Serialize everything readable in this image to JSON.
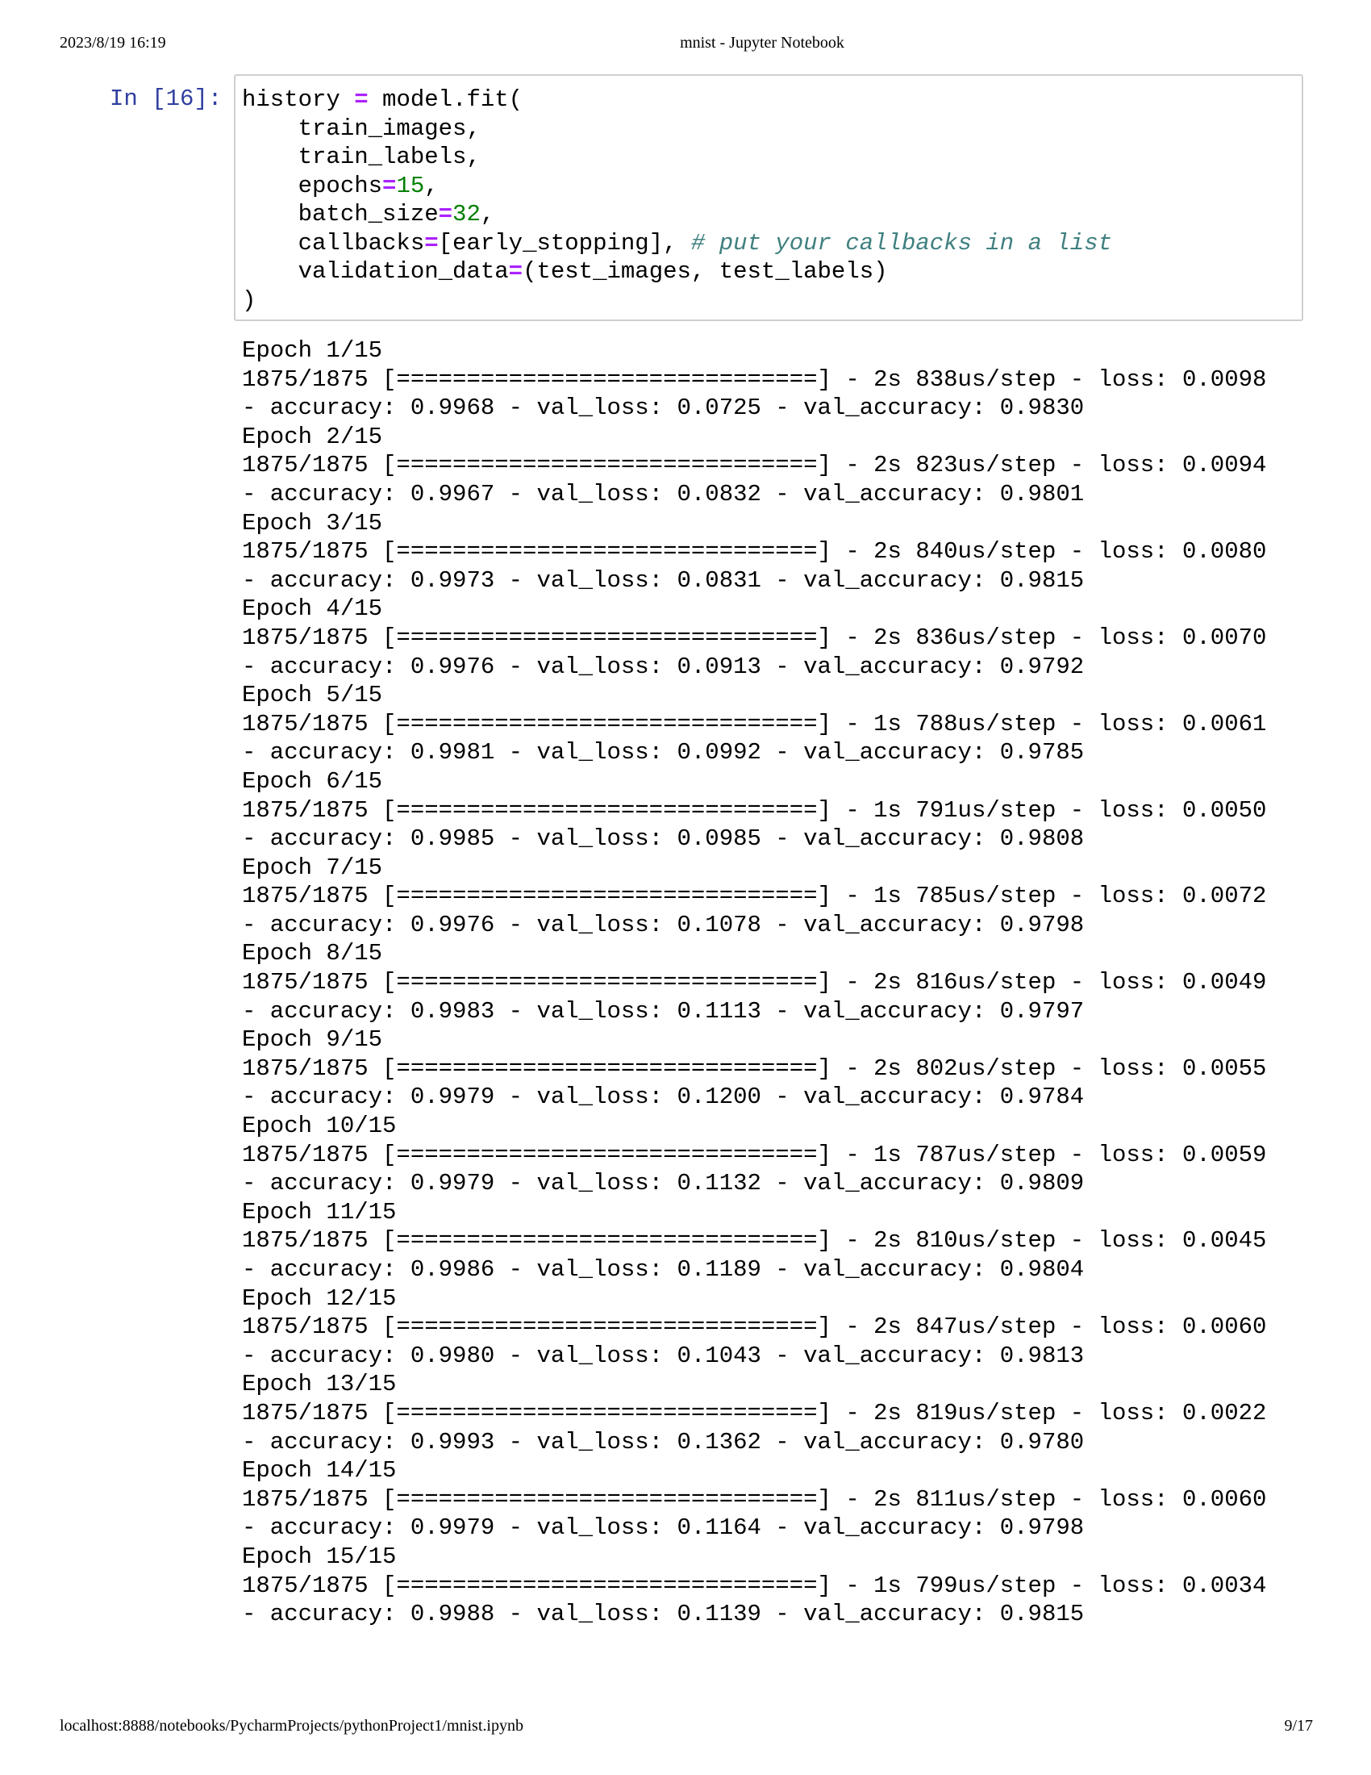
{
  "header": {
    "datetime": "2023/8/19 16:19",
    "title": "mnist - Jupyter Notebook"
  },
  "footer": {
    "url": "localhost:8888/notebooks/PycharmProjects/pythonProject1/mnist.ipynb",
    "page": "9/17"
  },
  "cell": {
    "prompt": "In [16]:",
    "code": {
      "l1_var": "history",
      "l1_op": " = ",
      "l1_call": "model.fit(",
      "l2": "    train_images,",
      "l3": "    train_labels,",
      "l4_name": "    epochs",
      "l4_op": "=",
      "l4_val": "15",
      "l4_end": ",",
      "l5_name": "    batch_size",
      "l5_op": "=",
      "l5_val": "32",
      "l5_end": ",",
      "l6_name": "    callbacks",
      "l6_op": "=",
      "l6_val": "[early_stopping], ",
      "l6_comment": "# put your callbacks in a list",
      "l7_name": "    validation_data",
      "l7_op": "=",
      "l7_val": "(test_images, test_labels)",
      "l8": ")"
    },
    "output": [
      "Epoch 1/15",
      "1875/1875 [==============================] - 2s 838us/step - loss: 0.0098",
      "- accuracy: 0.9968 - val_loss: 0.0725 - val_accuracy: 0.9830",
      "Epoch 2/15",
      "1875/1875 [==============================] - 2s 823us/step - loss: 0.0094",
      "- accuracy: 0.9967 - val_loss: 0.0832 - val_accuracy: 0.9801",
      "Epoch 3/15",
      "1875/1875 [==============================] - 2s 840us/step - loss: 0.0080",
      "- accuracy: 0.9973 - val_loss: 0.0831 - val_accuracy: 0.9815",
      "Epoch 4/15",
      "1875/1875 [==============================] - 2s 836us/step - loss: 0.0070",
      "- accuracy: 0.9976 - val_loss: 0.0913 - val_accuracy: 0.9792",
      "Epoch 5/15",
      "1875/1875 [==============================] - 1s 788us/step - loss: 0.0061",
      "- accuracy: 0.9981 - val_loss: 0.0992 - val_accuracy: 0.9785",
      "Epoch 6/15",
      "1875/1875 [==============================] - 1s 791us/step - loss: 0.0050",
      "- accuracy: 0.9985 - val_loss: 0.0985 - val_accuracy: 0.9808",
      "Epoch 7/15",
      "1875/1875 [==============================] - 1s 785us/step - loss: 0.0072",
      "- accuracy: 0.9976 - val_loss: 0.1078 - val_accuracy: 0.9798",
      "Epoch 8/15",
      "1875/1875 [==============================] - 2s 816us/step - loss: 0.0049",
      "- accuracy: 0.9983 - val_loss: 0.1113 - val_accuracy: 0.9797",
      "Epoch 9/15",
      "1875/1875 [==============================] - 2s 802us/step - loss: 0.0055",
      "- accuracy: 0.9979 - val_loss: 0.1200 - val_accuracy: 0.9784",
      "Epoch 10/15",
      "1875/1875 [==============================] - 1s 787us/step - loss: 0.0059",
      "- accuracy: 0.9979 - val_loss: 0.1132 - val_accuracy: 0.9809",
      "Epoch 11/15",
      "1875/1875 [==============================] - 2s 810us/step - loss: 0.0045",
      "- accuracy: 0.9986 - val_loss: 0.1189 - val_accuracy: 0.9804",
      "Epoch 12/15",
      "1875/1875 [==============================] - 2s 847us/step - loss: 0.0060",
      "- accuracy: 0.9980 - val_loss: 0.1043 - val_accuracy: 0.9813",
      "Epoch 13/15",
      "1875/1875 [==============================] - 2s 819us/step - loss: 0.0022",
      "- accuracy: 0.9993 - val_loss: 0.1362 - val_accuracy: 0.9780",
      "Epoch 14/15",
      "1875/1875 [==============================] - 2s 811us/step - loss: 0.0060",
      "- accuracy: 0.9979 - val_loss: 0.1164 - val_accuracy: 0.9798",
      "Epoch 15/15",
      "1875/1875 [==============================] - 1s 799us/step - loss: 0.0034",
      "- accuracy: 0.9988 - val_loss: 0.1139 - val_accuracy: 0.9815"
    ]
  },
  "colors": {
    "prompt": "#303f9f",
    "operator": "#aa22ff",
    "number": "#008000",
    "comment": "#408080",
    "cell_border": "#cfcfcf"
  }
}
